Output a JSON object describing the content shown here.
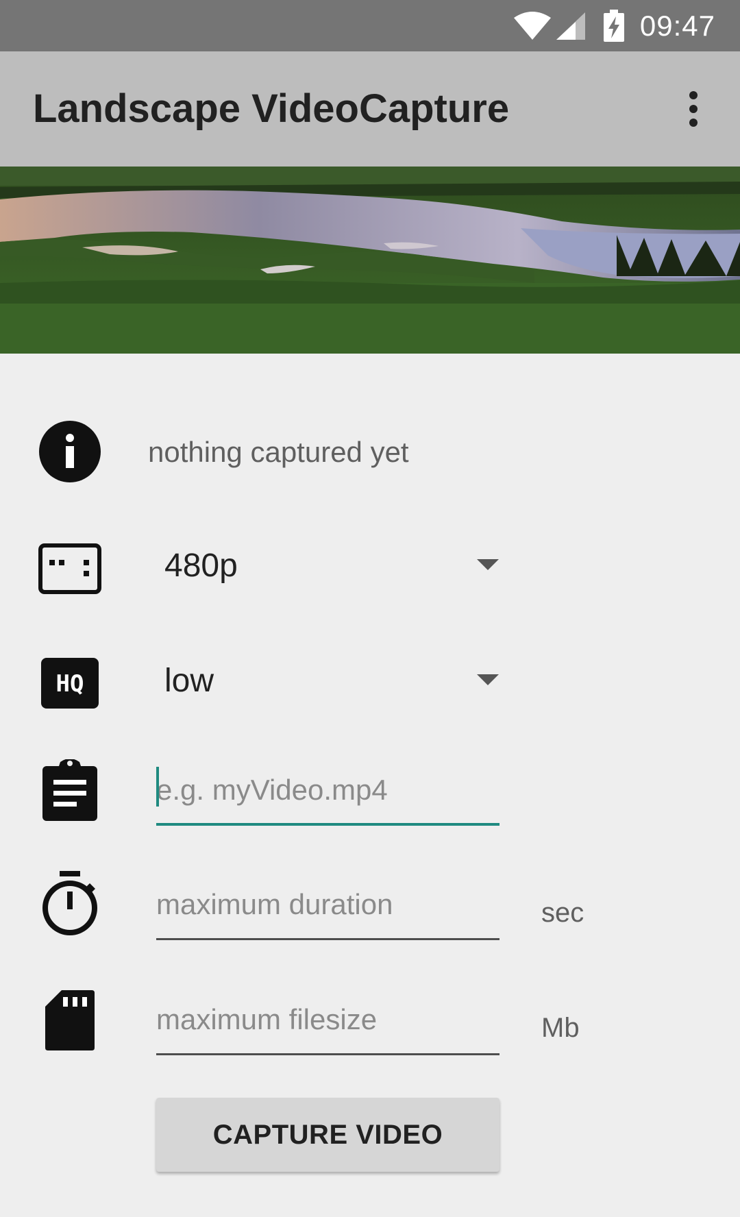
{
  "status_bar": {
    "time": "09:47",
    "icons": [
      "wifi-icon",
      "cell-signal-icon",
      "battery-charging-icon"
    ]
  },
  "app_bar": {
    "title": "Landscape VideoCapture",
    "menu_icon": "more-vert-icon"
  },
  "hero": {
    "icon": "landscape-lake-image"
  },
  "info": {
    "icon": "info-icon",
    "text": "nothing captured yet"
  },
  "resolution": {
    "icon": "aspect-ratio-icon",
    "selected": "480p"
  },
  "quality": {
    "icon": "hq-icon",
    "selected": "low"
  },
  "filename": {
    "icon": "clipboard-icon",
    "value": "",
    "placeholder": "e.g. myVideo.mp4"
  },
  "duration": {
    "icon": "timer-icon",
    "value": "",
    "placeholder": "maximum duration",
    "unit": "sec"
  },
  "filesize": {
    "icon": "sd-card-icon",
    "value": "",
    "placeholder": "maximum filesize",
    "unit": "Mb"
  },
  "capture_button": {
    "label": "CAPTURE VIDEO"
  },
  "colors": {
    "accent": "#1f8a80",
    "app_bar": "#bdbdbd",
    "status_bar": "#757575",
    "background": "#eeeeee"
  }
}
